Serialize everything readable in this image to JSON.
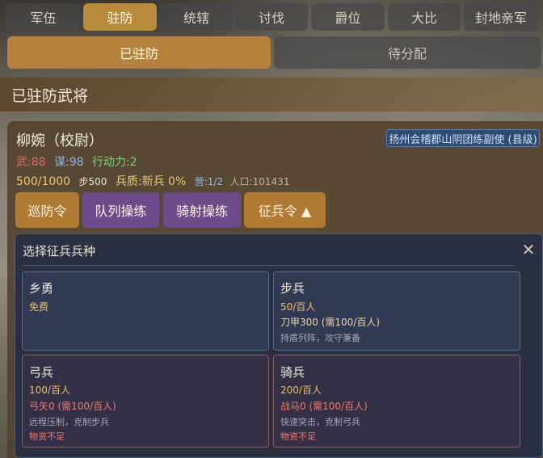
{
  "tabs": [
    "军伍",
    "驻防",
    "统辖",
    "讨伐",
    "爵位",
    "大比",
    "封地亲军"
  ],
  "subtabs": {
    "active": "已驻防",
    "inactive": "待分配"
  },
  "section_title": "已驻防武将",
  "general": {
    "name": "柳婉（校尉）",
    "post": "扬州会稽郡山阴团练副使 (县级)",
    "stats": {
      "wu": "武:88",
      "mou": "谋:98",
      "ap": "行动力:2"
    },
    "troops": "500/1000",
    "infantry": "步500",
    "quality": "兵质:新兵 0%",
    "camp": "营:1/2",
    "population": "人口:101431"
  },
  "commands": [
    "巡防令",
    "队列操练",
    "骑射操练",
    "征兵令 ▲"
  ],
  "picker": {
    "title": "选择征兵兵种",
    "close_icon": "close-icon",
    "units": [
      {
        "name": "乡勇",
        "cost": "免费",
        "req": "",
        "desc": "",
        "status": ""
      },
      {
        "name": "步兵",
        "cost": "50/百人",
        "req": "刀甲300 (需100/百人)",
        "desc": "持盾列阵，攻守兼备",
        "status": ""
      },
      {
        "name": "弓兵",
        "cost": "100/百人",
        "req": "弓矢0 (需100/百人)",
        "desc": "远程压制，克制步兵",
        "status": "物资不足"
      },
      {
        "name": "骑兵",
        "cost": "200/百人",
        "req": "战马0 (需100/百人)",
        "desc": "快速突击，克制弓兵",
        "status": "物资不足"
      }
    ]
  },
  "colors": {
    "accent": "#b88a3c",
    "command_purple": "#6e4b8a",
    "warning": "#ef7a6e"
  }
}
